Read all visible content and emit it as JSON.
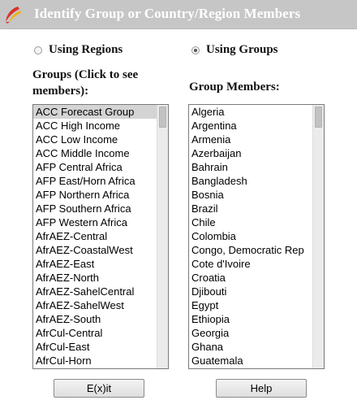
{
  "window": {
    "title": "Identify Group or Country/Region Members"
  },
  "mode": {
    "regions_label": "Using Regions",
    "groups_label": "Using Groups",
    "selected": "groups"
  },
  "groups_panel": {
    "heading": "Groups (Click to see members):",
    "items": [
      "ACC Forecast Group",
      "ACC High Income",
      "ACC Low Income",
      "ACC Middle Income",
      "AFP Central Africa",
      "AFP East/Horn Africa",
      "AFP Northern Africa",
      "AFP Southern Africa",
      "AFP Western Africa",
      "AfrAEZ-Central",
      "AfrAEZ-CoastalWest",
      "AfrAEZ-East",
      "AfrAEZ-North",
      "AfrAEZ-SahelCentral",
      "AfrAEZ-SahelWest",
      "AfrAEZ-South",
      "AfrCul-Central",
      "AfrCul-East",
      "AfrCul-Horn"
    ],
    "selected_index": 0
  },
  "members_panel": {
    "heading": "Group Members:",
    "items": [
      "Algeria",
      "Argentina",
      "Armenia",
      "Azerbaijan",
      "Bahrain",
      "Bangladesh",
      "Bosnia",
      "Brazil",
      "Chile",
      "Colombia",
      "Congo, Democratic Rep",
      "Cote d'Ivoire",
      "Croatia",
      "Djibouti",
      "Egypt",
      "Ethiopia",
      "Georgia",
      "Ghana",
      "Guatemala"
    ]
  },
  "buttons": {
    "exit": "E(x)it",
    "help": "Help"
  }
}
